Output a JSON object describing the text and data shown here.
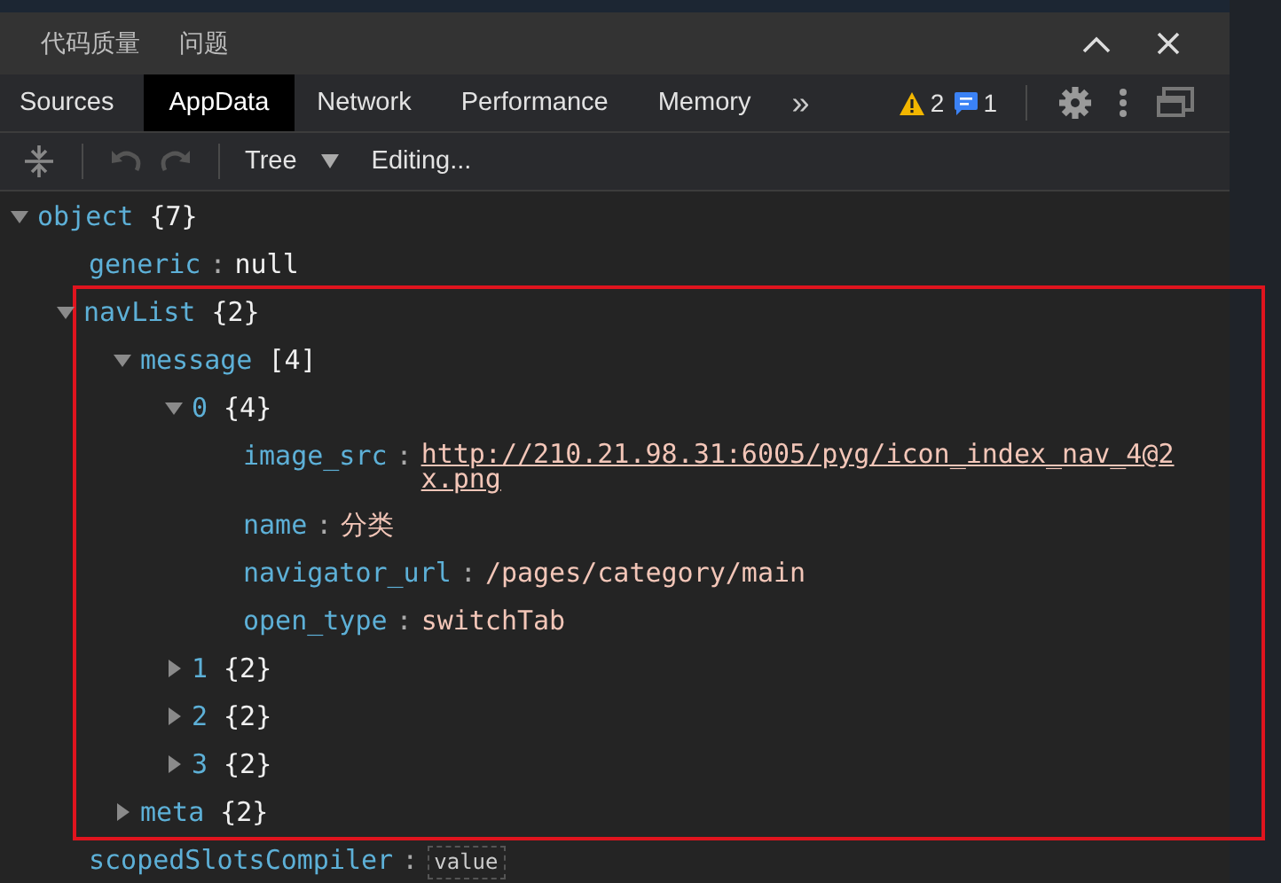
{
  "drawer_tabs": [
    {
      "label": "代码质量",
      "selected": false
    },
    {
      "label": "问题",
      "selected": false
    }
  ],
  "tabs": [
    {
      "label": "Sources",
      "selected": false
    },
    {
      "label": "AppData",
      "selected": true
    },
    {
      "label": "Network",
      "selected": false
    },
    {
      "label": "Performance",
      "selected": false
    },
    {
      "label": "Memory",
      "selected": false
    }
  ],
  "more_tabs": "»",
  "warnings": "2",
  "messages": "1",
  "toolbar": {
    "undo_disabled": true,
    "redo_disabled": true,
    "mode": "Tree",
    "status": "Editing..."
  },
  "tree": [
    {
      "key": "object",
      "count": "{7}",
      "expanded": true,
      "children": [
        {
          "key": "generic",
          "separator": ":",
          "value": "null",
          "kind": "null"
        },
        {
          "key": "navList",
          "count": "{2}",
          "expanded": true,
          "highlighted": true,
          "children": [
            {
              "key": "message",
              "count": "[4]",
              "expanded": true,
              "children": [
                {
                  "key": "0",
                  "count": "{4}",
                  "expanded": true,
                  "children": [
                    {
                      "key": "image_src",
                      "separator": ":",
                      "value": "http://210.21.98.31:6005/pyg/icon_index_nav_4@2x.png",
                      "kind": "link"
                    },
                    {
                      "key": "name",
                      "separator": ":",
                      "value": "分类",
                      "kind": "string"
                    },
                    {
                      "key": "navigator_url",
                      "separator": ":",
                      "value": "/pages/category/main",
                      "kind": "string"
                    },
                    {
                      "key": "open_type",
                      "separator": ":",
                      "value": "switchTab",
                      "kind": "string"
                    }
                  ]
                },
                {
                  "key": "1",
                  "count": "{2}",
                  "expanded": false
                },
                {
                  "key": "2",
                  "count": "{2}",
                  "expanded": false
                },
                {
                  "key": "3",
                  "count": "{2}",
                  "expanded": false
                }
              ]
            },
            {
              "key": "meta",
              "count": "{2}",
              "expanded": false
            }
          ]
        },
        {
          "key": "scopedSlotsCompiler",
          "separator": ":",
          "value": "value",
          "kind": "field"
        }
      ]
    }
  ]
}
